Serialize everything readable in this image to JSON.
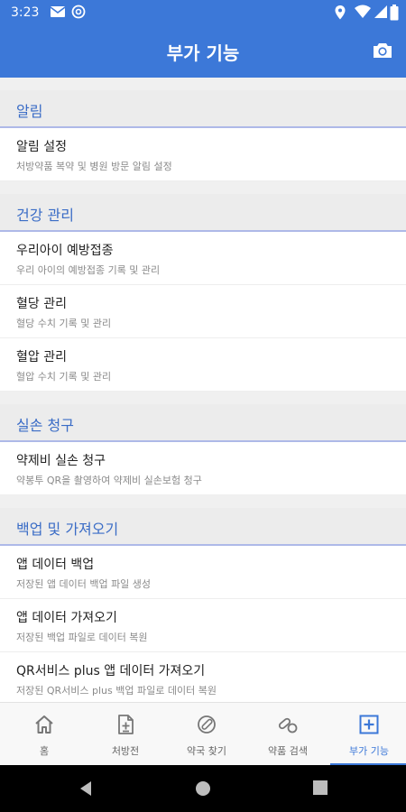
{
  "status_bar": {
    "time": "3:23",
    "icons": [
      "mail-icon",
      "at-sign-icon",
      "location-icon",
      "wifi-icon",
      "signal-icon",
      "battery-icon"
    ]
  },
  "app_bar": {
    "title": "부가 기능",
    "camera_icon": "camera-icon"
  },
  "sections": [
    {
      "title": "알림",
      "items": [
        {
          "title": "알림 설정",
          "subtitle": "처방약품 복약 및 병원 방문 알림 설정"
        }
      ]
    },
    {
      "title": "건강 관리",
      "items": [
        {
          "title": "우리아이 예방접종",
          "subtitle": "우리 아이의 예방접종 기록 및 관리"
        },
        {
          "title": "혈당 관리",
          "subtitle": "혈당 수치 기록 및 관리"
        },
        {
          "title": "혈압 관리",
          "subtitle": "혈압 수치 기록 및 관리"
        }
      ]
    },
    {
      "title": "실손 청구",
      "items": [
        {
          "title": "약제비 실손 청구",
          "subtitle": "약봉투 QR을 촬영하여 약제비 실손보험 청구"
        }
      ]
    },
    {
      "title": "백업 및 가져오기",
      "items": [
        {
          "title": "앱 데이터 백업",
          "subtitle": "저장된 앱 데이터 백업 파일 생성"
        },
        {
          "title": "앱 데이터 가져오기",
          "subtitle": "저장된 백업 파일로 데이터 복원"
        },
        {
          "title": "QR서비스 plus 앱 데이터 가져오기",
          "subtitle": "저장된 QR서비스 plus 백업 파일로 데이터 복원"
        }
      ]
    }
  ],
  "bottom_nav": [
    {
      "label": "홈",
      "icon": "home-icon"
    },
    {
      "label": "처방전",
      "icon": "prescription-icon"
    },
    {
      "label": "약국 찾기",
      "icon": "pharmacy-search-icon"
    },
    {
      "label": "약품 검색",
      "icon": "pill-search-icon"
    },
    {
      "label": "부가 기능",
      "icon": "add-box-icon",
      "active": true
    }
  ],
  "colors": {
    "primary": "#3c78d8",
    "section_title": "#3a6cc6",
    "section_bg": "#ececec"
  }
}
